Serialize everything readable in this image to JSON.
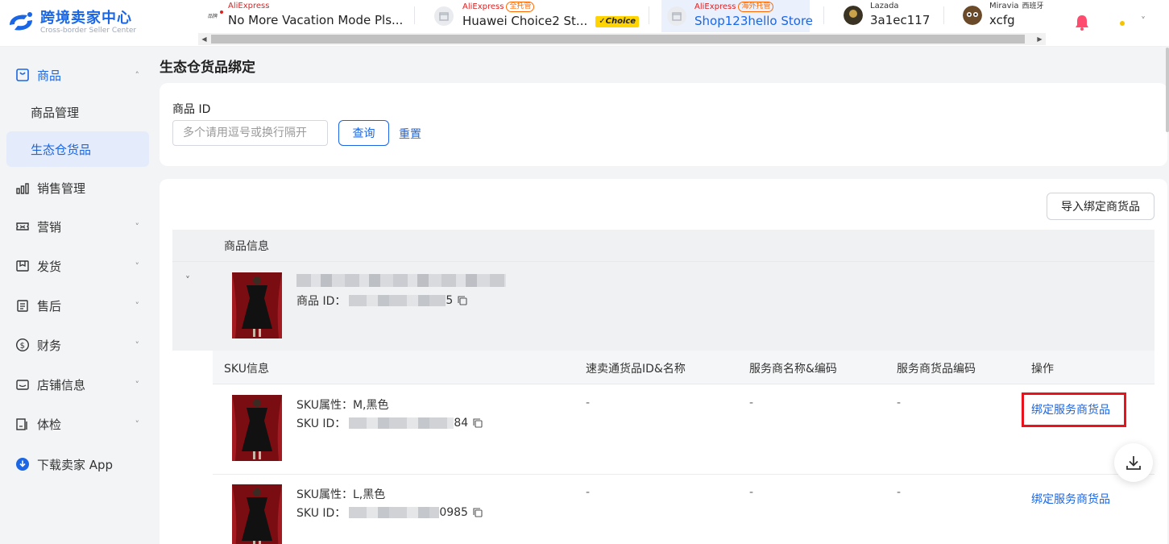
{
  "app": {
    "title": "跨境卖家中心",
    "subtitle": "Cross-border Seller Center"
  },
  "shops": [
    {
      "platform": "AliExpress",
      "tag": "",
      "name": "No More Vacation Mode Pls...",
      "active": false
    },
    {
      "platform": "AliExpress",
      "tag": "全托管",
      "name": "Huawei Choice2 St...",
      "badge": "Choice",
      "active": false
    },
    {
      "platform": "AliExpress",
      "tag": "海外托管",
      "name": "Shop123hello Store",
      "active": true
    },
    {
      "platform": "Lazada",
      "tag": "",
      "name": "3a1ec117",
      "active": false
    },
    {
      "platform": "Miravia",
      "tag": "西班牙",
      "name": "xcfg",
      "active": false
    }
  ],
  "sidebar": {
    "items": [
      {
        "label": "商品",
        "icon": "product-icon",
        "type": "group",
        "chevron": "˄"
      },
      {
        "label": "商品管理",
        "type": "sub"
      },
      {
        "label": "生态仓货品",
        "type": "sub",
        "selected": true
      },
      {
        "label": "销售管理",
        "icon": "bar-chart-icon",
        "type": "top"
      },
      {
        "label": "营销",
        "icon": "ticket-icon",
        "type": "top",
        "chevron": "˅"
      },
      {
        "label": "发货",
        "icon": "box-icon",
        "type": "top",
        "chevron": "˅"
      },
      {
        "label": "售后",
        "icon": "clipboard-icon",
        "type": "top",
        "chevron": "˅"
      },
      {
        "label": "财务",
        "icon": "dollar-icon",
        "type": "top",
        "chevron": "˅"
      },
      {
        "label": "店铺信息",
        "icon": "store-icon",
        "type": "top",
        "chevron": "˅"
      },
      {
        "label": "体检",
        "icon": "checkup-icon",
        "type": "top",
        "chevron": "˅"
      },
      {
        "label": "下载卖家 App",
        "icon": "download-app-icon",
        "type": "top"
      }
    ]
  },
  "page": {
    "title": "生态仓货品绑定"
  },
  "filter": {
    "label": "商品 ID",
    "placeholder": "多个请用逗号或换行隔开",
    "query": "查询",
    "reset": "重置"
  },
  "list": {
    "import_button": "导入绑定商货品",
    "header_product": "商品信息",
    "product": {
      "id_label": "商品 ID：",
      "id_suffix": "5"
    },
    "sku_headers": [
      "SKU信息",
      "速卖通货品ID&名称",
      "服务商名称&编码",
      "服务商货品编码",
      "操作"
    ],
    "skus": [
      {
        "attr": "SKU属性：M,黑色",
        "id_label": "SKU ID：",
        "id_suffix": "84",
        "col2": "-",
        "col3": "-",
        "col4": "-",
        "action": "绑定服务商货品"
      },
      {
        "attr": "SKU属性：L,黑色",
        "id_label": "SKU ID：",
        "id_suffix": "0985",
        "col2": "-",
        "col3": "-",
        "col4": "-",
        "action": "绑定服务商货品"
      }
    ]
  },
  "colors": {
    "accent": "#1a66e5",
    "highlight": "#e8131c"
  }
}
